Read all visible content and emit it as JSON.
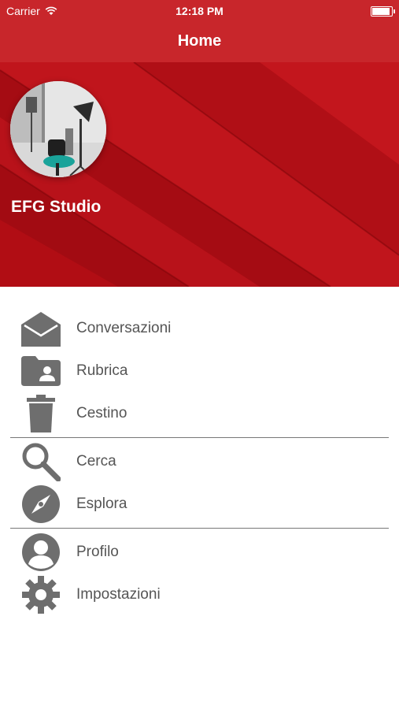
{
  "status_bar": {
    "carrier": "Carrier",
    "time": "12:18 PM",
    "wifi_icon": "wifi-icon",
    "battery_level": 1.0
  },
  "nav": {
    "title": "Home"
  },
  "header": {
    "studio_name": "EFG Studio",
    "avatar_image": "photo-studio-with-lights-and-chair",
    "background_color": "#b10d14"
  },
  "menu": {
    "groups": [
      [
        {
          "label": "Conversazioni",
          "icon": "envelope-open-icon"
        },
        {
          "label": "Rubrica",
          "icon": "contacts-folder-icon"
        },
        {
          "label": "Cestino",
          "icon": "trash-icon"
        }
      ],
      [
        {
          "label": "Cerca",
          "icon": "search-icon"
        },
        {
          "label": "Esplora",
          "icon": "compass-icon"
        }
      ],
      [
        {
          "label": "Profilo",
          "icon": "profile-icon"
        },
        {
          "label": "Impostazioni",
          "icon": "gear-icon"
        }
      ]
    ]
  },
  "colors": {
    "accent": "#c8262b",
    "icon": "#6e6e6e",
    "text": "#555555"
  }
}
